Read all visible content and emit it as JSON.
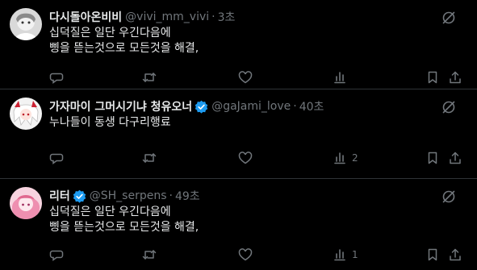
{
  "colors": {
    "background": "#000000",
    "text": "#e7e9ea",
    "secondary_text": "#71767b",
    "divider": "#2f3336",
    "verified_badge": "#1d9bf0"
  },
  "tweets": [
    {
      "name": "다시돌아온비비",
      "handle": "@vivi_mm_vivi",
      "separator": "·",
      "time": "3초",
      "verified": false,
      "body_lines": [
        "십덕질은 일단 우긴다음에",
        "삥을 뜯는것으로 모든것을 해결,"
      ],
      "actions": {
        "replies": "",
        "reposts": "",
        "likes": "",
        "views": ""
      },
      "icons": [
        "grok-icon",
        "reply-icon",
        "repost-icon",
        "like-icon",
        "views-icon",
        "bookmark-icon",
        "share-icon"
      ]
    },
    {
      "name": "가자마이 그머시기냐 청유오너",
      "handle": "@gaJami_love",
      "separator": "·",
      "time": "40초",
      "verified": true,
      "body_lines": [
        "누나들이 동생 다구리행료"
      ],
      "actions": {
        "replies": "",
        "reposts": "",
        "likes": "",
        "views": "2"
      },
      "icons": [
        "grok-icon",
        "reply-icon",
        "repost-icon",
        "like-icon",
        "views-icon",
        "bookmark-icon",
        "share-icon"
      ]
    },
    {
      "name": "리터",
      "handle": "@SH_serpens",
      "separator": "·",
      "time": "49초",
      "verified": true,
      "body_lines": [
        "십덕질은 일단 우긴다음에",
        "삥을 뜯는것으로 모든것을 해결,"
      ],
      "actions": {
        "replies": "",
        "reposts": "",
        "likes": "",
        "views": "1"
      },
      "icons": [
        "grok-icon",
        "reply-icon",
        "repost-icon",
        "like-icon",
        "views-icon",
        "bookmark-icon",
        "share-icon"
      ]
    }
  ]
}
